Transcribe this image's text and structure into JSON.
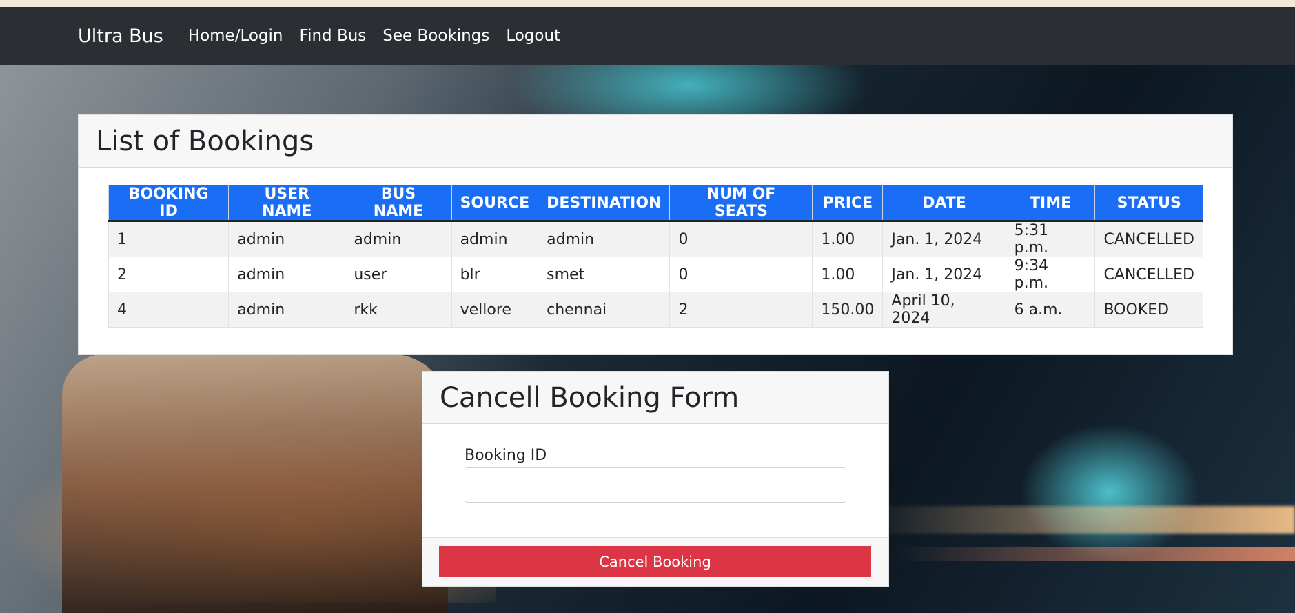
{
  "navbar": {
    "brand": "Ultra Bus",
    "links": [
      "Home/Login",
      "Find Bus",
      "See Bookings",
      "Logout"
    ]
  },
  "bookings": {
    "title": "List of Bookings",
    "columns": [
      "BOOKING ID",
      "USER NAME",
      "BUS NAME",
      "SOURCE",
      "DESTINATION",
      "NUM OF SEATS",
      "PRICE",
      "DATE",
      "TIME",
      "STATUS"
    ],
    "rows": [
      [
        "1",
        "admin",
        "admin",
        "admin",
        "admin",
        "0",
        "1.00",
        "Jan. 1, 2024",
        "5:31 p.m.",
        "CANCELLED"
      ],
      [
        "2",
        "admin",
        "user",
        "blr",
        "smet",
        "0",
        "1.00",
        "Jan. 1, 2024",
        "9:34 p.m.",
        "CANCELLED"
      ],
      [
        "4",
        "admin",
        "rkk",
        "vellore",
        "chennai",
        "2",
        "150.00",
        "April 10, 2024",
        "6 a.m.",
        "BOOKED"
      ]
    ]
  },
  "cancel_form": {
    "title": "Cancell Booking Form",
    "field_label": "Booking ID",
    "field_value": "",
    "button_label": "Cancel Booking"
  },
  "colors": {
    "navbar": "#2b2f33",
    "table_header": "#1a6ef5",
    "danger": "#dc3545"
  }
}
